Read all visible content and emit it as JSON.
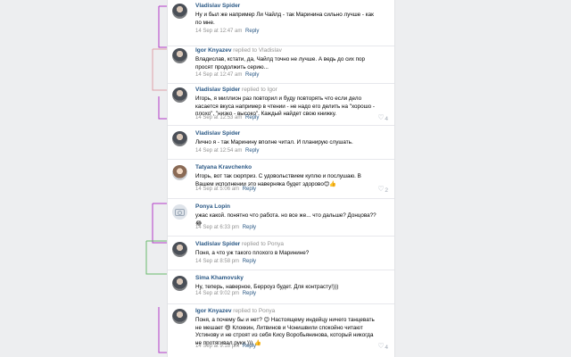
{
  "colors": {
    "accent_purple": "#b339c9",
    "accent_pink": "#e0a0a8",
    "accent_green": "#69b96b",
    "link": "#2a5885"
  },
  "comments": [
    {
      "author": "Vladislav Spider",
      "replied": "",
      "avatar": "male",
      "text": "Ну и был же например Ли Чайлд - так Маринина сильно лучше - как по мне.",
      "date": "14 Sep at 12:47 am",
      "reply": "Reply",
      "likes": ""
    },
    {
      "author": "Igor Knyazev",
      "replied": "replied to Vladislav",
      "avatar": "male",
      "text": "Владислав, кстати, да, Чайлд точно не лучше. А ведь до сих пор просят продолжить серию...",
      "date": "14 Sep at 12:47 am",
      "reply": "Reply",
      "likes": ""
    },
    {
      "author": "Vladislav Spider",
      "replied": "replied to Igor",
      "avatar": "male",
      "text": "Игорь, я миллион раз повторил и буду повторять что если дело касается вкуса например в чтении - не надо его делить на \"хорошо - плохо\", \"низко - высоко\". Каждый найдет свою книжку.",
      "date": "14 Sep at 12:53 am",
      "reply": "Reply",
      "likes": "4"
    },
    {
      "author": "Vladislav Spider",
      "replied": "",
      "avatar": "male",
      "text": "Лично я - так Маринину вполне читал. И планирую слушать.",
      "date": "14 Sep at 12:54 am",
      "reply": "Reply",
      "likes": ""
    },
    {
      "author": "Tatyana Kravchenko",
      "replied": "",
      "avatar": "female",
      "text": "Игорь, вот так сюрприз. С удовольствием куплю и послушаю. В Вашем исполнении это наверняка будет здорово😊👍",
      "date": "14 Sep at 5:06 am",
      "reply": "Reply",
      "likes": "2"
    },
    {
      "author": "Ponya Lopin",
      "replied": "",
      "avatar": "camera",
      "text": "ужас какой. понятно что работа. но все же... что дальше? Донцова??😂",
      "date": "14 Sep at 6:33 pm",
      "reply": "Reply",
      "likes": ""
    },
    {
      "author": "Vladislav Spider",
      "replied": "replied to Ponya",
      "avatar": "male",
      "text": "Поня, а что уж такого плохого в Маринине?",
      "date": "14 Sep at 8:58 pm",
      "reply": "Reply",
      "likes": ""
    },
    {
      "author": "Sima Khamovsky",
      "replied": "",
      "avatar": "male",
      "text": "Ну, теперь, наверное, Берроуз будет. Для контрасту!)))",
      "date": "14 Sep at 9:02 pm",
      "reply": "Reply",
      "likes": ""
    },
    {
      "author": "Igor Knyazev",
      "replied": "replied to Ponya",
      "avatar": "male",
      "text": "Поня, а почему бы и нет? 😉 Настоящему индейцу ничего танцевать не мешает 😄 Клоккин, Литвинов и Чонишвили спокойно читают Устинову и не строят из себя Кису Воробьянинова, который никогда не протягивал руки ))) 👍",
      "date": "14 Sep at 9:18 pm",
      "reply": "Reply",
      "likes": "4"
    }
  ]
}
